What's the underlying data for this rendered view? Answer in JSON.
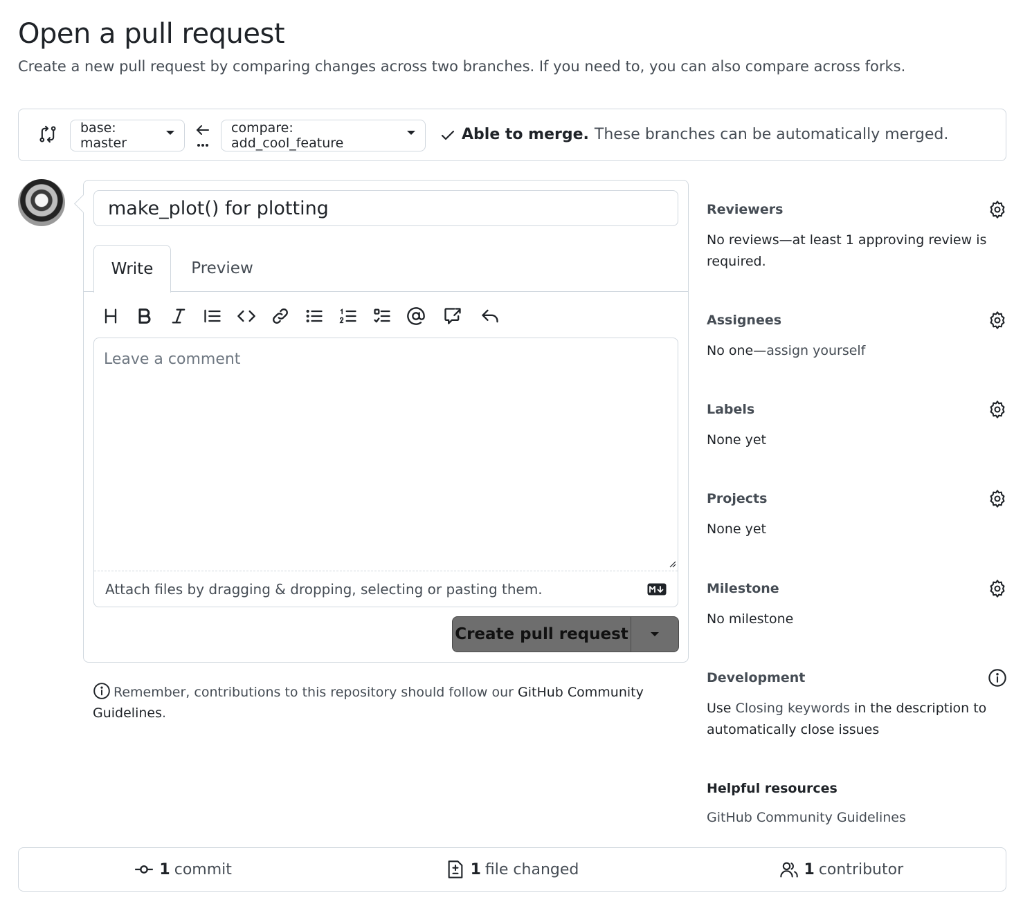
{
  "header": {
    "title": "Open a pull request",
    "subtitle": "Create a new pull request by comparing changes across two branches. If you need to, you can also compare across forks."
  },
  "range": {
    "base_label": "base: master",
    "compare_label": "compare: add_cool_feature",
    "merge_status": "Able to merge.",
    "merge_desc": "These branches can be automatically merged."
  },
  "compose": {
    "title_value": "make_plot() for plotting",
    "tabs": [
      {
        "label": "Write"
      },
      {
        "label": "Preview"
      }
    ],
    "comment_placeholder": "Leave a comment",
    "attach_text": "Attach files by dragging & dropping, selecting or pasting them.",
    "submit_label": "Create pull request"
  },
  "reminder": {
    "prefix": "Remember, contributions to this repository should follow our ",
    "link": "GitHub Community Guidelines",
    "suffix": "."
  },
  "sidebar": {
    "reviewers": {
      "heading": "Reviewers",
      "body": "No reviews—at least 1 approving review is required."
    },
    "assignees": {
      "heading": "Assignees",
      "body_prefix": "No one—",
      "body_link": "assign yourself"
    },
    "labels": {
      "heading": "Labels",
      "body": "None yet"
    },
    "projects": {
      "heading": "Projects",
      "body": "None yet"
    },
    "milestone": {
      "heading": "Milestone",
      "body": "No milestone"
    },
    "development": {
      "heading": "Development",
      "body_prefix": "Use ",
      "body_link": "Closing keywords",
      "body_suffix": " in the description to automatically close issues"
    },
    "resources": {
      "heading": "Helpful resources",
      "link": "GitHub Community Guidelines"
    }
  },
  "summary": {
    "commits_count": "1",
    "commits_label": "commit",
    "files_count": "1",
    "files_label": "file changed",
    "contributors_count": "1",
    "contributors_label": "contributor"
  },
  "icons": {
    "compare": "git-compare-icon",
    "arrow": "arrow-left-icon",
    "check": "check-icon",
    "gear": "gear-icon",
    "info": "info-icon",
    "markdown": "markdown-icon",
    "toolbar": [
      "heading-icon",
      "bold-icon",
      "italic-icon",
      "quote-icon",
      "code-icon",
      "link-icon",
      "unordered-list-icon",
      "ordered-list-icon",
      "task-list-icon",
      "mention-icon",
      "cross-reference-icon",
      "reply-icon"
    ]
  }
}
